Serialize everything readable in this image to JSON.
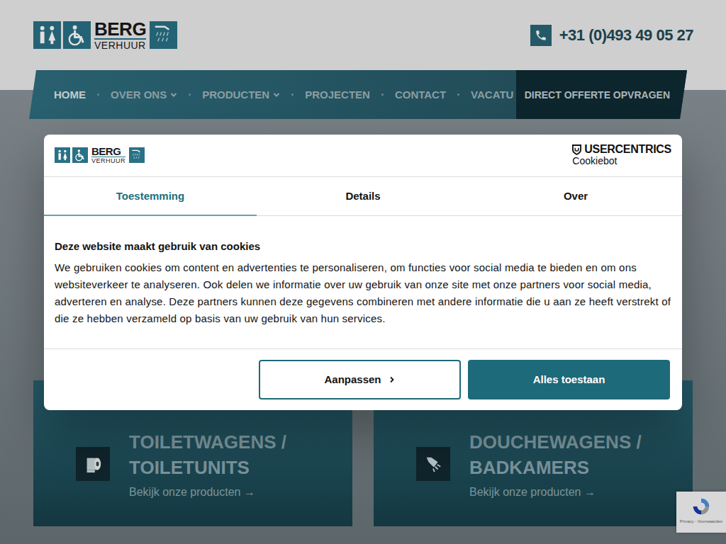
{
  "header": {
    "logo": {
      "title": "BERG",
      "subtitle": "VERHUUR"
    },
    "phone": "+31 (0)493 49 05 27"
  },
  "nav": {
    "items": [
      {
        "label": "HOME",
        "selected": true,
        "dropdown": false
      },
      {
        "label": "OVER ONS",
        "selected": false,
        "dropdown": true
      },
      {
        "label": "PRODUCTEN",
        "selected": false,
        "dropdown": true
      },
      {
        "label": "PROJECTEN",
        "selected": false,
        "dropdown": false
      },
      {
        "label": "CONTACT",
        "selected": false,
        "dropdown": false
      },
      {
        "label": "VACATU",
        "selected": false,
        "dropdown": false
      }
    ],
    "cta": "DIRECT OFFERTE OPVRAGEN"
  },
  "cards": [
    {
      "kind": "toilet",
      "titleLines": [
        "TOILETWAGENS /",
        "TOILETUNITS"
      ],
      "link": "Bekijk onze producten",
      "arrow": "→"
    },
    {
      "kind": "shower",
      "titleLines": [
        "DOUCHEWAGENS /",
        "BADKAMERS"
      ],
      "link": "Bekijk onze producten",
      "arrow": "→"
    }
  ],
  "cookieDialog": {
    "logo": {
      "title": "BERG",
      "subtitle": "VERHUUR"
    },
    "brand": {
      "name": "USERCENTRICS",
      "product": "Cookiebot"
    },
    "tabs": [
      {
        "label": "Toestemming",
        "selected": true
      },
      {
        "label": "Details",
        "selected": false
      },
      {
        "label": "Over",
        "selected": false
      }
    ],
    "title": "Deze website maakt gebruik van cookies",
    "body": "We gebruiken cookies om content en advertenties te personaliseren, om functies voor social media te bieden en om ons websiteverkeer te analyseren. Ook delen we informatie over uw gebruik van onze site met onze partners voor social media, adverteren en analyse. Deze partners kunnen deze gegevens combineren met andere informatie die u aan ze heeft verstrekt of die ze hebben verzameld op basis van uw gebruik van hun services.",
    "buttons": [
      {
        "label": "Aanpassen",
        "kind": "secondary"
      },
      {
        "label": "Alles toestaan",
        "kind": "primary"
      }
    ]
  },
  "recaptcha": {
    "text": "Privacy - Voorwaarden"
  }
}
